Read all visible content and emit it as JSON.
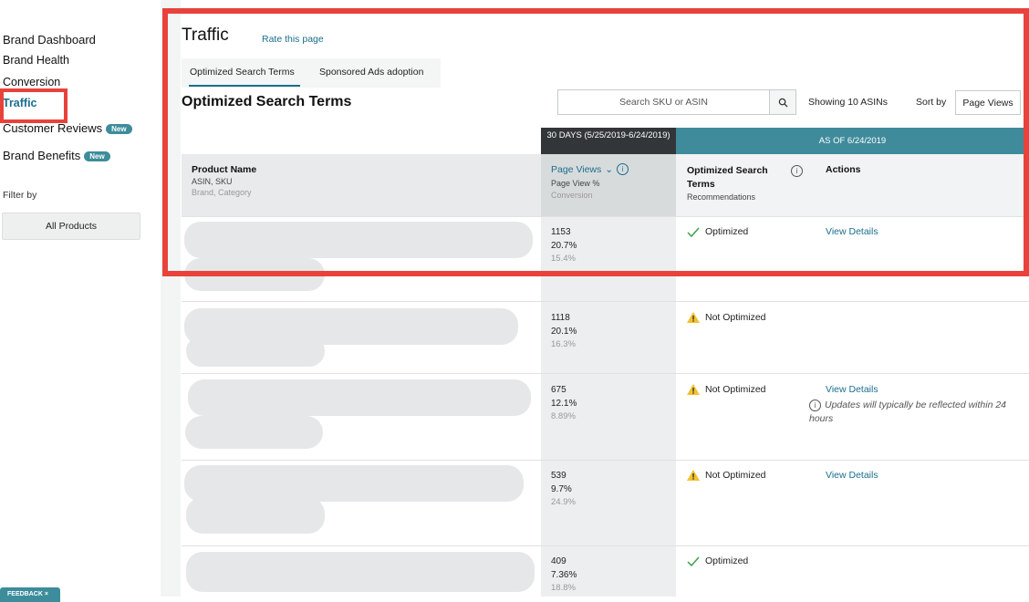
{
  "sidebar": {
    "items": [
      {
        "label": "Brand Dashboard"
      },
      {
        "label": "Brand Health"
      },
      {
        "label": "Conversion"
      },
      {
        "label": "Traffic"
      },
      {
        "label": "Customer Reviews",
        "badge": "New"
      },
      {
        "label": "Brand Benefits",
        "badge": "New"
      }
    ],
    "filter_label": "Filter by",
    "filter_button": "All Products",
    "feedback": "FEEDBACK"
  },
  "page": {
    "title": "Traffic",
    "rate_link": "Rate this page",
    "tabs": [
      {
        "label": "Optimized Search Terms",
        "active": true
      },
      {
        "label": "Sponsored Ads adoption",
        "active": false
      }
    ],
    "section_title": "Optimized Search Terms",
    "search_placeholder": "Search SKU or ASIN",
    "showing": "Showing 10 ASINs",
    "sort_label": "Sort by",
    "sort_value": "Page Views"
  },
  "table": {
    "period_header": "30 DAYS (5/25/2019-6/24/2019)",
    "asof_header": "AS OF 6/24/2019",
    "col_product": "Product Name",
    "col_product_sub": "ASIN, SKU",
    "col_product_sub2": "Brand, Category",
    "col_pageviews": "Page Views",
    "col_pageviews_sub": "Page View %",
    "col_pageviews_sub2": "Conversion",
    "col_ost": "Optimized Search Terms",
    "col_ost_sub": "Recommendations",
    "col_actions": "Actions",
    "rows": [
      {
        "views": "1153",
        "pct": "20.7%",
        "conv": "15.4%",
        "status": "Optimized",
        "action": "View Details"
      },
      {
        "views": "1118",
        "pct": "20.1%",
        "conv": "16.3%",
        "status": "Not Optimized",
        "action": ""
      },
      {
        "views": "675",
        "pct": "12.1%",
        "conv": "8.89%",
        "status": "Not Optimized",
        "action": "View Details"
      },
      {
        "views": "539",
        "pct": "9.7%",
        "conv": "24.9%",
        "status": "Not Optimized",
        "action": "View Details"
      },
      {
        "views": "409",
        "pct": "7.36%",
        "conv": "18.8%",
        "status": "Optimized",
        "action": ""
      }
    ],
    "update_note": "Updates will typically be reflected within 24 hours"
  },
  "colors": {
    "accent": "#1a6e8e",
    "highlight": "#e8423b",
    "teal_header": "#3f8b9b"
  }
}
